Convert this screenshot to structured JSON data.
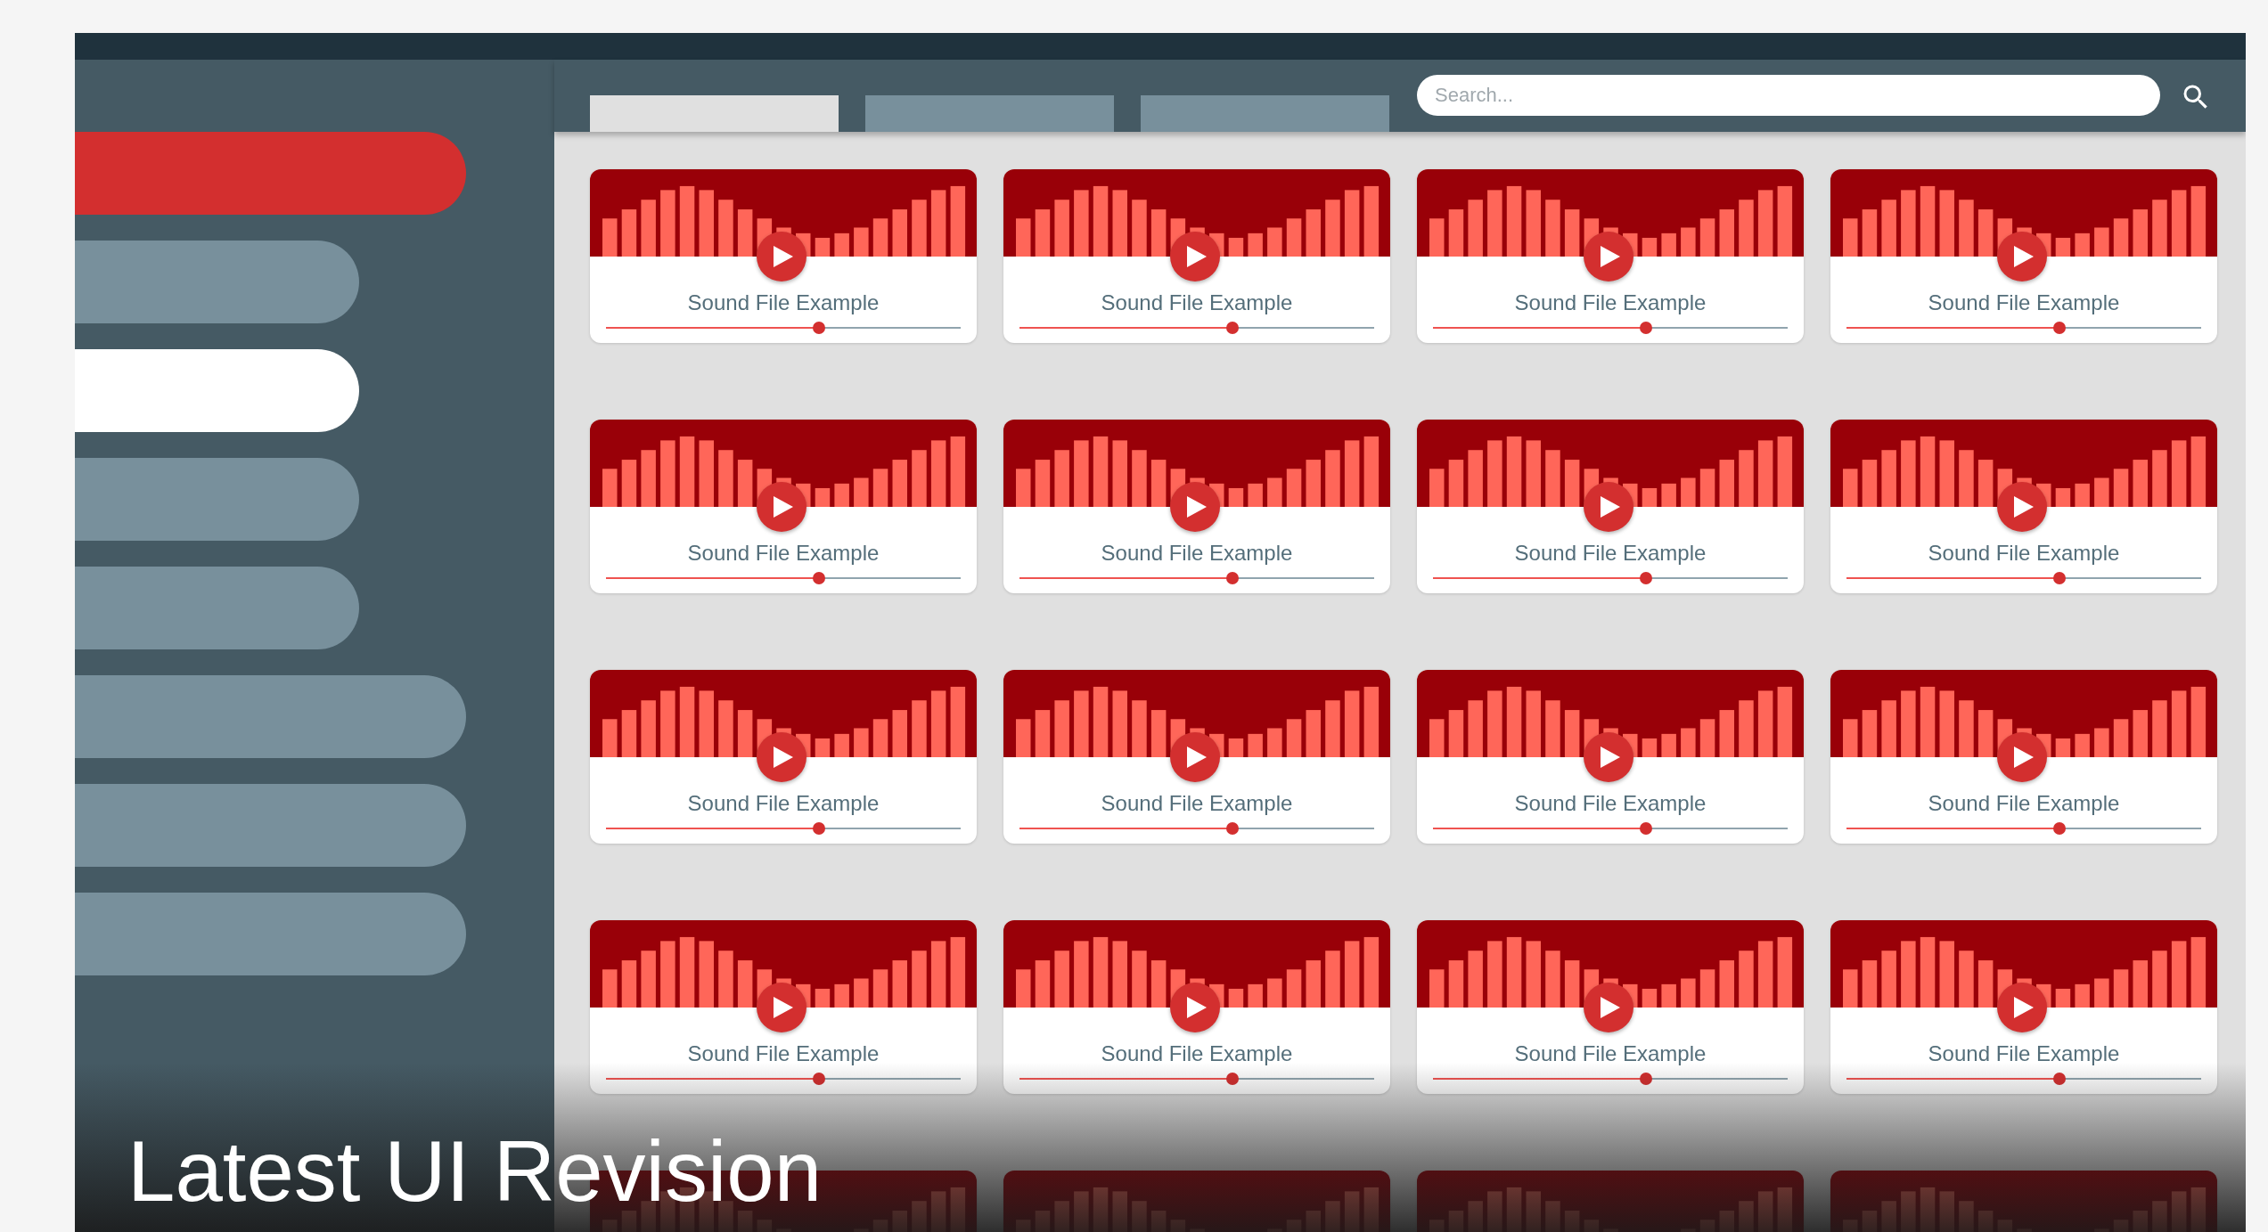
{
  "sidebar": {
    "items": [
      {
        "kind": "wide",
        "color": "#d32f2f"
      },
      {
        "kind": "narrow",
        "color": "#78909c"
      },
      {
        "kind": "narrow",
        "color": "#ffffff"
      },
      {
        "kind": "narrow",
        "color": "#78909c"
      },
      {
        "kind": "narrow",
        "color": "#78909c"
      },
      {
        "kind": "wide",
        "color": "#78909c"
      },
      {
        "kind": "wide",
        "color": "#78909c"
      },
      {
        "kind": "wide",
        "color": "#78909c"
      }
    ]
  },
  "tabs": [
    {
      "selected": true
    },
    {
      "selected": false
    },
    {
      "selected": false
    }
  ],
  "search": {
    "placeholder": "Search..."
  },
  "cards": [
    {
      "kind": "full",
      "title": "Sound File Example",
      "level": 0.6
    },
    {
      "kind": "full",
      "title": "Sound File Example",
      "level": 0.6
    },
    {
      "kind": "full",
      "title": "Sound File Example",
      "level": 0.6
    },
    {
      "kind": "full",
      "title": "Sound File Example",
      "level": 0.6
    },
    {
      "kind": "full",
      "title": "Sound File Example",
      "level": 0.6
    },
    {
      "kind": "full",
      "title": "Sound File Example",
      "level": 0.6
    },
    {
      "kind": "full",
      "title": "Sound File Example",
      "level": 0.6
    },
    {
      "kind": "full",
      "title": "Sound File Example",
      "level": 0.6
    },
    {
      "kind": "full",
      "title": "Sound File Example",
      "level": 0.6
    },
    {
      "kind": "full",
      "title": "Sound File Example",
      "level": 0.6
    },
    {
      "kind": "full",
      "title": "Sound File Example",
      "level": 0.6
    },
    {
      "kind": "full",
      "title": "Sound File Example",
      "level": 0.6
    },
    {
      "kind": "full",
      "title": "Sound File Example",
      "level": 0.6
    },
    {
      "kind": "full",
      "title": "Sound File Example",
      "level": 0.6
    },
    {
      "kind": "full",
      "title": "Sound File Example",
      "level": 0.6
    },
    {
      "kind": "full",
      "title": "Sound File Example",
      "level": 0.6
    },
    {
      "kind": "cut"
    },
    {
      "kind": "cut"
    },
    {
      "kind": "cut"
    },
    {
      "kind": "cut"
    }
  ],
  "caption": "Latest UI Revision"
}
